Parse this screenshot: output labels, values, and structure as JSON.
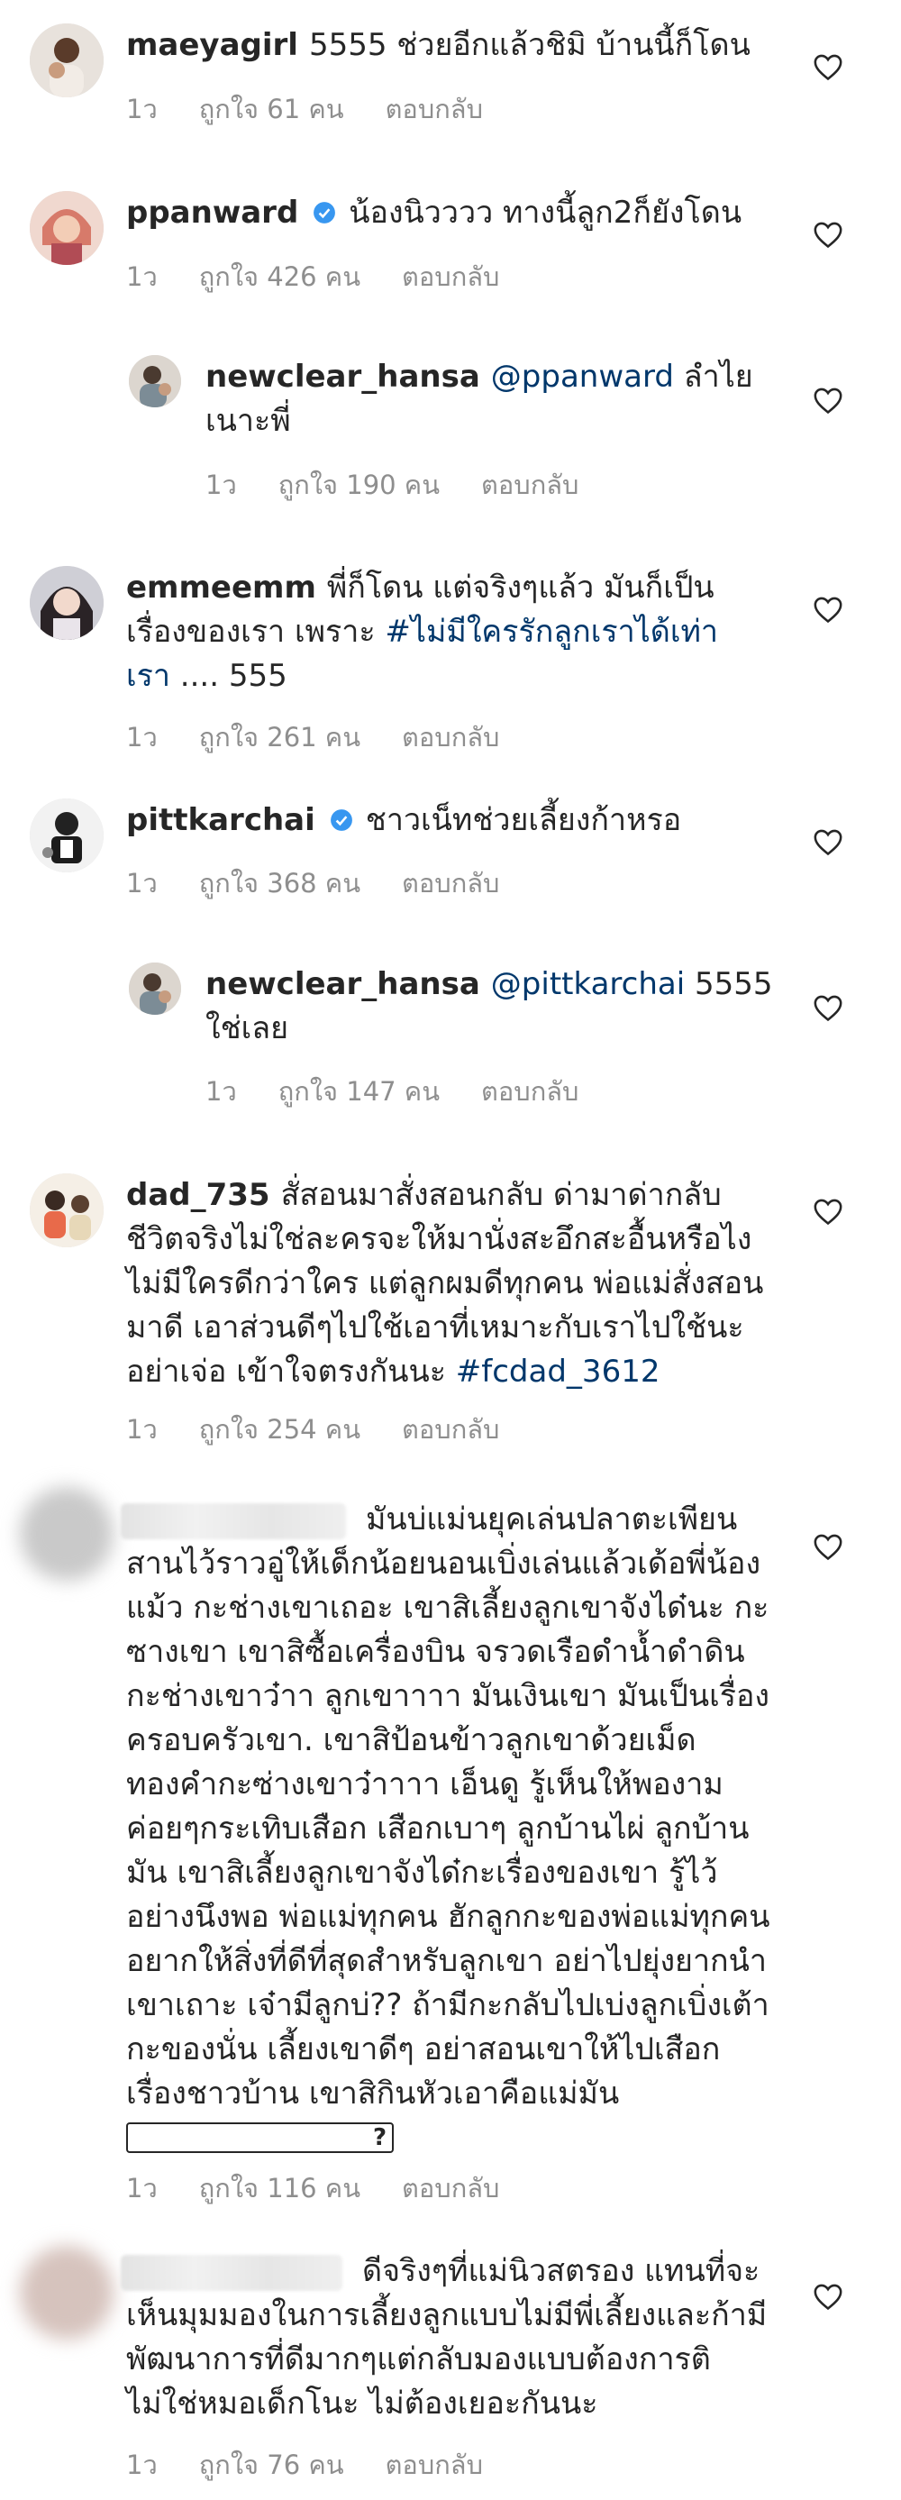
{
  "comments": [
    {
      "username": "maeyagirl",
      "text": "5555 ช่วยอีกแล้วชิมิ บ้านนี้ก็โดน",
      "time": "1ว",
      "likes": "ถูกใจ 61 คน",
      "reply_label": "ตอบกลับ"
    },
    {
      "username": "ppanward",
      "verified": true,
      "text": "น้องนิวววว ทางนี้ลูก2ก็ยังโดน",
      "time": "1ว",
      "likes": "ถูกใจ 426 คน",
      "reply_label": "ตอบกลับ"
    },
    {
      "username": "newclear_hansa",
      "mention": "@ppanward",
      "text": "ลำไยเนาะพี่",
      "time": "1ว",
      "likes": "ถูกใจ 190 คน",
      "reply_label": "ตอบกลับ"
    },
    {
      "username": "emmeemm",
      "text": "พี่ก็โดน แต่จริงๆแล้ว มันก็เป็นเรื่องของเรา เพราะ",
      "hashtag": "#ไม่มีใครรักลูกเราได้เท่าเรา",
      "text_after": " .... 555",
      "time": "1ว",
      "likes": "ถูกใจ 261 คน",
      "reply_label": "ตอบกลับ"
    },
    {
      "username": "pittkarchai",
      "verified": true,
      "text": "ชาวเน็ทช่วยเลี้ยงก้าหรอ",
      "time": "1ว",
      "likes": "ถูกใจ 368 คน",
      "reply_label": "ตอบกลับ"
    },
    {
      "username": "newclear_hansa",
      "mention": "@pittkarchai",
      "text": "5555 ใช่เลย",
      "time": "1ว",
      "likes": "ถูกใจ 147 คน",
      "reply_label": "ตอบกลับ"
    },
    {
      "username": "dad_735",
      "text": "สั่สอนมาสั่งสอนกลับ ด่ามาด่ากลับ ชีวิตจริงไม่ใช่ละครจะให้มานั่งสะอึกสะอื้นหรือไง ไม่มีใครดีกว่าใคร แต่ลูกผมดีทุกคน พ่อแม่สั่งสอนมาดี เอาส่วนดีๆไปใช้เอาที่เหมาะกับเราไปใช้นะ อย่าเจ่อ เข้าใจตรงกันนะ",
      "hashtag": "#fcdad_3612",
      "time": "1ว",
      "likes": "ถูกใจ 254 คน",
      "reply_label": "ตอบกลับ"
    },
    {
      "text": "มันบ่แม่นยุคเล่นปลาตะเพียน สานไว้ราวอู่ให้เด็กน้อยนอนเบิ่งเล่นแล้วเด้อพี่น้องแม้ว กะช่างเขาเถอะ เขาสิเลี้ยงลูกเขาจังได๋นะ กะซางเขา เขาสิซื้อเครื่องบิน จรวดเรือดำน้ำดำดินกะช่างเขาว๋าา ลูกเขาาาา มันเงินเขา มันเป็นเรื่องครอบครัวเขา. เขาสิป้อนข้าวลูกเขาด้วยเม็ดทองคำกะซ่างเขาว๋าาาา  เอ็นดู รู้เห็นให้พองาม ค่อยๆกระเทิบเสือก เสือกเบาๆ ลูกบ้านไผ่ ลูกบ้านมัน เขาสิเลี้ยงลูกเขาจังได๋กะเรื่องของเขา รู้ไว้อย่างนึงพอ พ่อแม่ทุกคน ฮักลูกกะของพ่อแม่ทุกคนอยากให้สิ่งที่ดีที่สุดสำหรับลูกเขา อย่าไปยุ่งยากนำเขาเถาะ เจ๋ามีลูกบ่?? ถ้ามีกะกลับไปเบ่งลูกเบิ่งเต้ากะของนั่น เลี้ยงเขาดีๆ อย่าสอนเขาให้ไปเสือกเรื่องชาวบ้าน เขาสิกินหัวเอาคือแม่มัน",
      "emoji_box": "?",
      "time": "1ว",
      "likes": "ถูกใจ 116 คน",
      "reply_label": "ตอบกลับ"
    },
    {
      "text": "ดีจริงๆที่แม่นิวสตรอง แทนที่จะเห็นมุมมองในการเลี้ยงลูกแบบไม่มีพี่เลี้ยงและก้ามีพัฒนาการที่ดีมากๆแต่กลับมองแบบต้องการติ ไม่ใช่หมอเด็กโนะ ไม่ต้องเยอะกันนะ",
      "time": "1ว",
      "likes": "ถูกใจ 76 คน",
      "reply_label": "ตอบกลับ"
    }
  ],
  "colors": {
    "text": "#262626",
    "meta": "#8e8e8e",
    "link": "#00376b",
    "verified": "#3897f0"
  },
  "icons": [
    "heart-icon",
    "verified-badge-icon",
    "avatar"
  ]
}
